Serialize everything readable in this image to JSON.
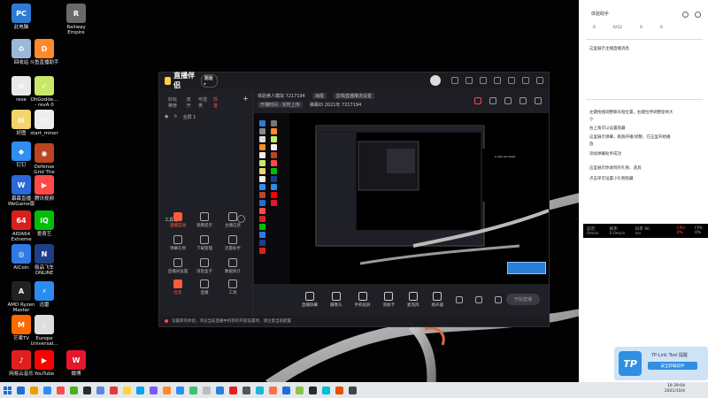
{
  "desktop_icons": [
    {
      "label": "此电脑",
      "color": "#2d7bd4",
      "glyph": "PC"
    },
    {
      "label": "Railway\nEmpire",
      "color": "#6a6a6a",
      "glyph": "R"
    },
    {
      "label": "回收站",
      "color": "#9bb8d8",
      "glyph": "♻"
    },
    {
      "label": "斗鱼直播助手",
      "color": "#ff8a2a",
      "glyph": "D"
    },
    {
      "label": "rese",
      "color": "#e8e8e8",
      "glyph": "≡"
    },
    {
      "label": "OhGodde...\n- revA 0",
      "color": "#c8e86a",
      "glyph": "✓"
    },
    {
      "label": "好图",
      "color": "#f2d56b",
      "glyph": "▤"
    },
    {
      "label": "start_miner",
      "color": "#eee",
      "glyph": "▭"
    },
    {
      "label": "钉钉",
      "color": "#2f8ef0",
      "glyph": "◆"
    },
    {
      "label": "Defense\nGrid The",
      "color": "#bb4422",
      "glyph": "◉"
    },
    {
      "label": "幕幕直播\nWeGame版",
      "color": "#2a6ad8",
      "glyph": "W"
    },
    {
      "label": "腾讯视频",
      "color": "#ff4a4a",
      "glyph": "▶"
    },
    {
      "label": "AIDA64\nExtreme",
      "color": "#d62020",
      "glyph": "64"
    },
    {
      "label": "爱奇艺",
      "color": "#00be06",
      "glyph": "iQ"
    },
    {
      "label": "AICoin",
      "color": "#2f7ae5",
      "glyph": "◎"
    },
    {
      "label": "极品飞车\nONLINE",
      "color": "#1f3e8a",
      "glyph": "N"
    },
    {
      "label": "AMD Ryzen\nMaster",
      "color": "#222",
      "glyph": "A"
    },
    {
      "label": "迅雷",
      "color": "#2a8cf0",
      "glyph": "⚡"
    },
    {
      "label": "芒果TV",
      "color": "#ff6a00",
      "glyph": "M"
    },
    {
      "label": "Europe\nUniversal...",
      "color": "#ddd",
      "glyph": "▯"
    },
    {
      "label": "网易云音乐",
      "color": "#e02020",
      "glyph": "♪"
    },
    {
      "label": "YouTube",
      "color": "#ff0000",
      "glyph": "▶"
    },
    {
      "label": "微博",
      "color": "#e6162d",
      "glyph": "W"
    }
  ],
  "app": {
    "title": "直播伴侣",
    "version_badge": "测速 ▸",
    "left_tabs": [
      "好玩推荐",
      "双开",
      "可选类",
      "抖音",
      "+"
    ],
    "left_row": [
      "◉",
      "↻",
      "全屏 1"
    ],
    "toolbox_title": "工具箱",
    "tools": [
      {
        "label": "直播互动",
        "highlight": true
      },
      {
        "label": "观看提示",
        "highlight": false
      },
      {
        "label": "主播信息",
        "highlight": false
      },
      {
        "label": "弹幕礼物",
        "highlight": false
      },
      {
        "label": "下载管理",
        "highlight": false
      },
      {
        "label": "流量助手",
        "highlight": false
      },
      {
        "label": "直播间设置",
        "highlight": false
      },
      {
        "label": "消息盒子",
        "highlight": false
      },
      {
        "label": "数据统计",
        "highlight": false
      },
      {
        "label": "红包",
        "highlight": true
      },
      {
        "label": "直播",
        "highlight": false
      },
      {
        "label": "工具",
        "highlight": false
      }
    ],
    "room_name": "体验黄人模拟 7217194",
    "pill1": "海报",
    "pill2": "剪辑直播推流设置",
    "row2_a": "开播时间 · 实时上传",
    "row2_b": "弹幕ID 2021年 7217194",
    "bottom_tools": [
      "直播屏幕",
      "摄像头",
      "手机投屏",
      "添加卡",
      "麦克风",
      "扬声器"
    ],
    "start_live": "开始直播",
    "status_text": "设置新的体验，浏览当前直播中的新的内容设置项，请注意当前配置"
  },
  "chat": {
    "title": "体验助手",
    "stats": [
      "0",
      "6/52",
      "0",
      "0"
    ],
    "welcome": "这里展示主播直播消息",
    "messages": [
      "左键拖拽调整聊天框位置，右键拉伸调整窗体大",
      "小",
      "右上角可以设置隐藏",
      "这里展示弹幕，跑跑开播/调整，在这里开始播",
      "放",
      "添加弹幕助手成功",
      "这里展示你收到的礼物、道具",
      "点击单可设置小礼物隐藏"
    ],
    "perf": [
      "延迟: 0ms/s",
      "帧率: 0.0ms/s",
      "码率 90 ms",
      "CPU: 0%",
      "FPS: 0%"
    ]
  },
  "toast": {
    "title": "TP-Link Tool 提醒",
    "button": "安全卸载软件"
  },
  "taskbar": {
    "time": "10:39:04",
    "date": "2021/10/4",
    "apps": [
      "#1c6fd6",
      "#e5a100",
      "#2f8ef0",
      "#ff4a4a",
      "#46b21b",
      "#2a2a2a",
      "#5b86e5",
      "#e53935",
      "#ffd23f",
      "#0aa2e8",
      "#7a5cff",
      "#ff8a2a",
      "#2f8ef0",
      "#3fc06b",
      "#bbb",
      "#2a7fd6",
      "#e02020",
      "#555",
      "#18b7d8",
      "#ff7043",
      "#1c6fd6",
      "#8bc34a",
      "#2a2a2a",
      "#00bcd4",
      "#e65100",
      "#444"
    ]
  }
}
